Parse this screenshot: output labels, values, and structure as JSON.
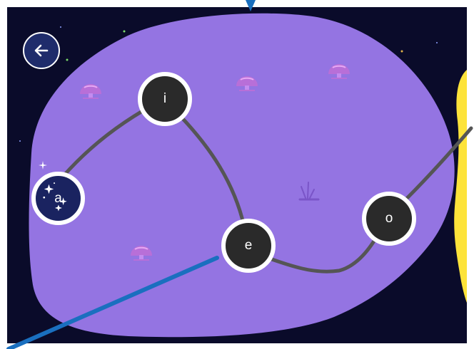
{
  "colors": {
    "frame": "#ffffff",
    "space": "#0a0b2a",
    "island": "#9474e2",
    "neighbor_island": "#fde33a",
    "path": "#555555",
    "node_fill": "#2a2a2a",
    "current_node_fill": "#1a2360",
    "node_border": "#ffffff",
    "pointer_line": "#1a6fbf"
  },
  "back_button": {
    "icon": "arrow-left-icon"
  },
  "nodes": [
    {
      "id": "a",
      "label": "a",
      "state": "current"
    },
    {
      "id": "i",
      "label": "i",
      "state": "available"
    },
    {
      "id": "e",
      "label": "e",
      "state": "available"
    },
    {
      "id": "o",
      "label": "o",
      "state": "available"
    }
  ],
  "decorations": {
    "mushroom_icon": "mushroom-icon",
    "grass_icon": "grass-tuft-icon",
    "sparkle_icon": "sparkle-icon",
    "star_icon": "star-icon"
  }
}
